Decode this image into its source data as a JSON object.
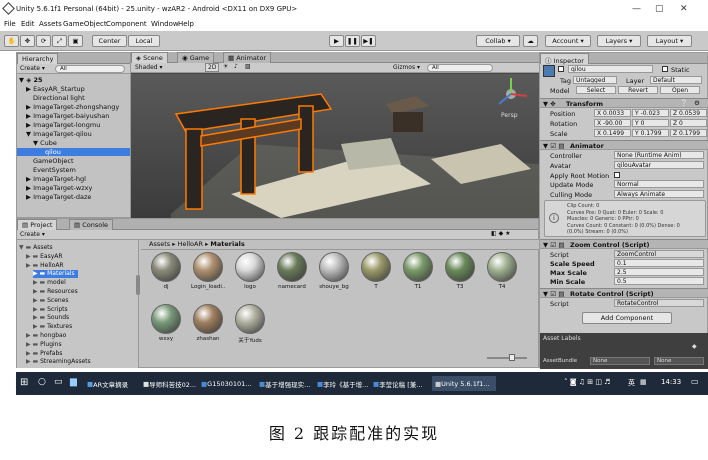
{
  "window": {
    "title": "Unity 5.6.1f1 Personal (64bit) - 25.unity - wzAR2 - Android <DX11 on DX9 GPU>"
  },
  "menu": [
    "File",
    "Edit",
    "Assets",
    "GameObject",
    "Component",
    "Window",
    "Help"
  ],
  "toolbar": {
    "pivot_label": "Center",
    "space_label": "Local",
    "collab_label": "Collab",
    "account_label": "Account",
    "layers_label": "Layers",
    "layout_label": "Layout"
  },
  "hierarchy": {
    "tab": "Hierarchy",
    "create_label": "Create",
    "search_placeholder": "All",
    "scene_name": "25",
    "items": [
      "EasyAR_Startup",
      "Directional light",
      "ImageTarget-zhongshangy",
      "ImageTarget-baiyushan",
      "ImageTarget-longmu",
      "ImageTarget-qilou",
      "Cube",
      "qilou",
      "GameObject",
      "EventSystem",
      "ImageTarget-hgl",
      "ImageTarget-wzxy",
      "ImageTarget-daze"
    ]
  },
  "scene": {
    "tabs": [
      "Scene",
      "Game",
      "Animator"
    ],
    "shading": "Shaded",
    "mode_2d": "2D",
    "gizmos_label": "Gizmos",
    "search_placeholder": "All",
    "persp_label": "Persp"
  },
  "inspector": {
    "tab": "Inspector",
    "object_name": "qilou",
    "static_label": "Static",
    "tag_label": "Tag",
    "tag_value": "Untagged",
    "layer_label": "Layer",
    "layer_value": "Default",
    "model_label": "Model",
    "select_label": "Select",
    "revert_label": "Revert",
    "open_label": "Open",
    "transform": {
      "title": "Transform",
      "position_label": "Position",
      "position": [
        "X 0.0033",
        "Y -0.023",
        "Z 0.0539"
      ],
      "rotation_label": "Rotation",
      "rotation": [
        "X -90.00",
        "Y 0",
        "Z 0"
      ],
      "scale_label": "Scale",
      "scale": [
        "X 0.1499",
        "Y 0.1799",
        "Z 0.1799"
      ]
    },
    "animator": {
      "title": "Animator",
      "controller_label": "Controller",
      "controller_value": "None (Runtime Anim)",
      "avatar_label": "Avatar",
      "avatar_value": "qilouAvatar",
      "root_motion_label": "Apply Root Motion",
      "update_mode_label": "Update Mode",
      "update_mode_value": "Normal",
      "culling_mode_label": "Culling Mode",
      "culling_mode_value": "Always Animate",
      "info_lines": [
        "Clip Count: 0",
        "Curves Pos: 0 Quat: 0 Euler: 0 Scale: 0",
        "Muscles: 0 Generic: 0 PPtr: 0",
        "Curves Count: 0 Constant: 0 (0.0%) Dense: 0",
        "(0.0%) Stream: 0 (0.0%)"
      ]
    },
    "zoom": {
      "title": "Zoom Control (Script)",
      "script_label": "Script",
      "script_value": "ZoomControl",
      "speed_label": "Scale Speed",
      "speed_value": "0.1",
      "max_label": "Max Scale",
      "max_value": "2.5",
      "min_label": "Min Scale",
      "min_value": "0.5"
    },
    "rotate": {
      "title": "Rotate Control (Script)",
      "script_label": "Script",
      "script_value": "RotateControl"
    },
    "add_component_label": "Add Component",
    "asset_labels_title": "Asset Labels",
    "asset_bundle_label": "AssetBundle",
    "asset_bundle_value": "None",
    "asset_bundle_variant": "None"
  },
  "project": {
    "tabs": [
      "Project",
      "Console"
    ],
    "create_label": "Create",
    "breadcrumb": [
      "Assets",
      "HelloAR",
      "Materials"
    ],
    "tree": [
      {
        "label": "Assets",
        "indent": 0
      },
      {
        "label": "EasyAR",
        "indent": 1
      },
      {
        "label": "HelloAR",
        "indent": 1
      },
      {
        "label": "Materials",
        "indent": 2,
        "selected": true
      },
      {
        "label": "model",
        "indent": 2
      },
      {
        "label": "Resources",
        "indent": 2
      },
      {
        "label": "Scenes",
        "indent": 2
      },
      {
        "label": "Scripts",
        "indent": 2
      },
      {
        "label": "Sounds",
        "indent": 2
      },
      {
        "label": "Textures",
        "indent": 2
      },
      {
        "label": "hongbao",
        "indent": 1
      },
      {
        "label": "Plugins",
        "indent": 1
      },
      {
        "label": "Prefabs",
        "indent": 1
      },
      {
        "label": "StreamingAssets",
        "indent": 1
      }
    ],
    "assets_row1": [
      "dj",
      "Login_loadi...",
      "logo",
      "namecard",
      "shouye_bg",
      "T",
      "T1",
      "T3",
      "T4"
    ],
    "assets_row2": [
      "wxxy",
      "zhashan",
      "关于Yuds"
    ],
    "asset_colors_row1": [
      "#8a8a7a",
      "#b09070",
      "#d8d8d8",
      "#6a7a5a",
      "#bdbdbd",
      "#9a9a6a",
      "#7a9a6a",
      "#6a8a5a",
      "#a0b090"
    ],
    "asset_colors_row2": [
      "#7a9a7a",
      "#a08060",
      "#b0b0a0"
    ]
  },
  "taskbar": {
    "items": [
      "AR文章摘录",
      "导师科苦技02...",
      "G15030101...",
      "基于增强现实...",
      "李玲《基于增...",
      "李莹论稿 [兼...",
      "Unity 5.6.1f1..."
    ],
    "lang": "英",
    "time": "14:33"
  },
  "caption": {
    "text": "图 2    跟踪配准的实现"
  }
}
